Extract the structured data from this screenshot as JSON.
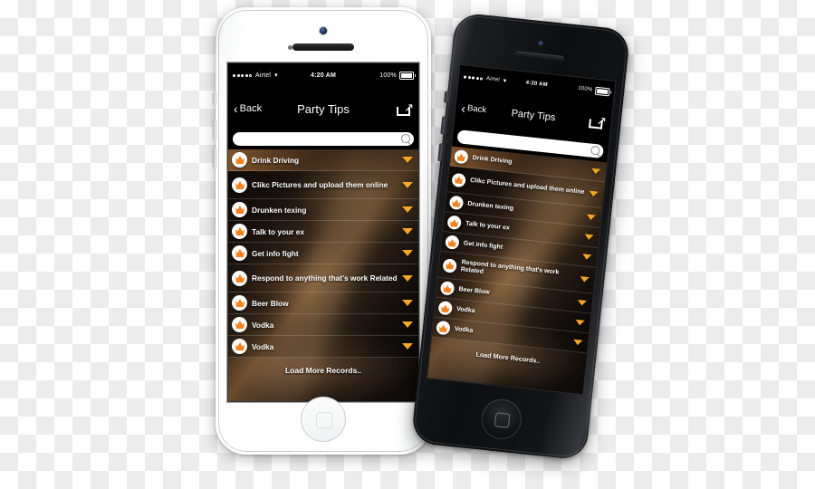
{
  "scene": {
    "devices": [
      {
        "id": "white-phone",
        "name": "iPhone 5 white",
        "color": "#ffffff"
      },
      {
        "id": "black-phone",
        "name": "iPhone 5 black",
        "color": "#111214"
      }
    ]
  },
  "app": {
    "statusbar": {
      "carrier": "Airtel",
      "wifi_icon": "wifi-icon",
      "time": "4:20 AM",
      "battery_percent": "100%",
      "signal_dots_filled": 4,
      "signal_dots_total": 5
    },
    "navbar": {
      "back_label": "Back",
      "back_icon": "chevron-left-icon",
      "title": "Party Tips",
      "share_icon": "share-icon"
    },
    "search": {
      "value": "",
      "placeholder": "",
      "icon": "search-icon"
    },
    "list": {
      "row_icon": "crown-icon",
      "row_caret_icon": "caret-down-icon",
      "accent_color": "#f5a623",
      "items": [
        {
          "label": "Drink Driving",
          "lines": 1
        },
        {
          "label": "Clikc Pictures and upload them online",
          "lines": 2
        },
        {
          "label": "Drunken texing",
          "lines": 1
        },
        {
          "label": "Talk to your ex",
          "lines": 1
        },
        {
          "label": "Get info fight",
          "lines": 1
        },
        {
          "label": "Respond to anything that's work Related",
          "lines": 2
        },
        {
          "label": "Beer Blow",
          "lines": 1
        },
        {
          "label": "Vodka",
          "lines": 1
        },
        {
          "label": "Vodka",
          "lines": 1
        }
      ]
    },
    "footer": {
      "load_more_label": "Load More Records.."
    }
  }
}
